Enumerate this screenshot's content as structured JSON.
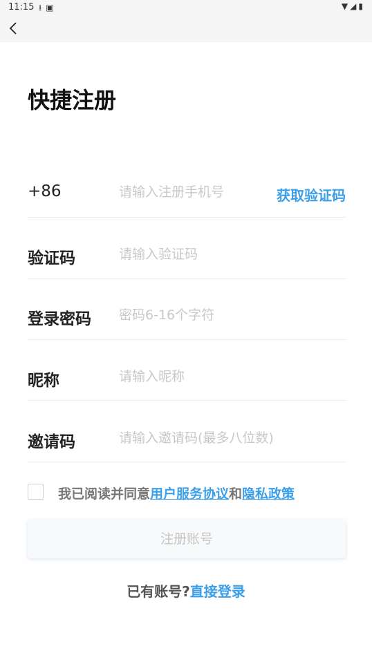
{
  "status_bar": {
    "time": "11:15",
    "left_icons": [
      "download-icon",
      "notification-icon"
    ],
    "right_icons": [
      "wifi-icon",
      "signal-icon",
      "battery-icon"
    ]
  },
  "header": {
    "back_icon": "back-arrow-icon"
  },
  "title": "快捷注册",
  "form": {
    "phone": {
      "prefix": "+86",
      "placeholder": "请输入注册手机号",
      "value": "",
      "code_button": "获取验证码"
    },
    "code": {
      "label": "验证码",
      "placeholder": "请输入验证码",
      "value": ""
    },
    "password": {
      "label": "登录密码",
      "placeholder": "密码6-16个字符",
      "value": ""
    },
    "nickname": {
      "label": "昵称",
      "placeholder": "请输入昵称",
      "value": ""
    },
    "invite": {
      "label": "邀请码",
      "placeholder": "请输入邀请码(最多八位数)",
      "value": ""
    }
  },
  "agreement": {
    "checked": false,
    "prefix": "我已阅读并同意",
    "link1": "用户服务协议",
    "joiner": "和",
    "link2": "隐私政策"
  },
  "register_button": "注册账号",
  "login": {
    "prefix": "已有账号?",
    "link": "直接登录"
  },
  "colors": {
    "accent": "#3a9fe8",
    "placeholder": "#c8c8c8",
    "disabled_button_text": "#c4c4c4"
  }
}
